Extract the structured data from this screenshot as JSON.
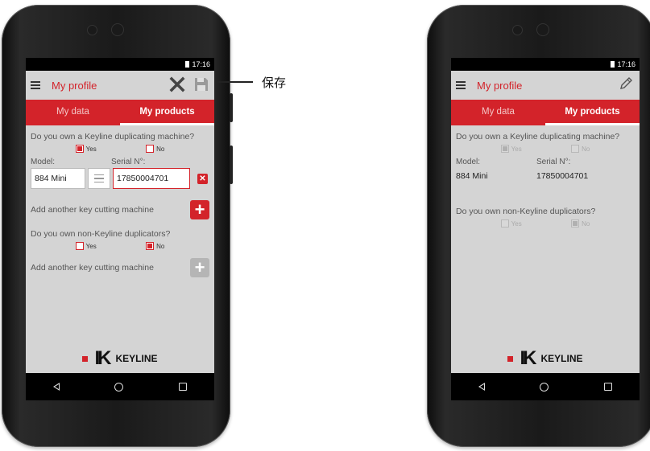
{
  "annotation": {
    "save_label": "保存"
  },
  "edit_phone": {
    "status_time": "17:16",
    "title": "My profile",
    "tabs": [
      "My data",
      "My products"
    ],
    "q1": "Do you own a Keyline duplicating machine?",
    "q1_yes": "Yes",
    "q1_no": "No",
    "model_label": "Model:",
    "serial_label": "Serial N°:",
    "model_value": "884 Mini",
    "serial_value": "17850004701",
    "add_machine_1": "Add another key cutting machine",
    "q2": "Do you own non-Keyline duplicators?",
    "q2_yes": "Yes",
    "q2_no": "No",
    "add_machine_2": "Add another key cutting machine",
    "logo_text": "KEYLINE",
    "q1_selected": "Yes",
    "q2_selected": "No"
  },
  "view_phone": {
    "status_time": "17:16",
    "title": "My profile",
    "tabs": [
      "My data",
      "My products"
    ],
    "q1": "Do you own a Keyline duplicating machine?",
    "q1_yes": "Yes",
    "q1_no": "No",
    "model_label": "Model:",
    "serial_label": "Serial N°:",
    "model_value": "884 Mini",
    "serial_value": "17850004701",
    "q2": "Do you own non-Keyline duplicators?",
    "q2_yes": "Yes",
    "q2_no": "No",
    "logo_text": "KEYLINE",
    "q1_selected": "Yes",
    "q2_selected": "No"
  },
  "colors": {
    "accent": "#d3232a",
    "screen_bg": "#d4d4d4"
  },
  "icons": [
    "menu-icon",
    "close-icon",
    "save-icon",
    "edit-pencil-icon",
    "remove-icon",
    "add-icon",
    "nav-back-icon",
    "nav-home-icon",
    "nav-recent-icon"
  ]
}
